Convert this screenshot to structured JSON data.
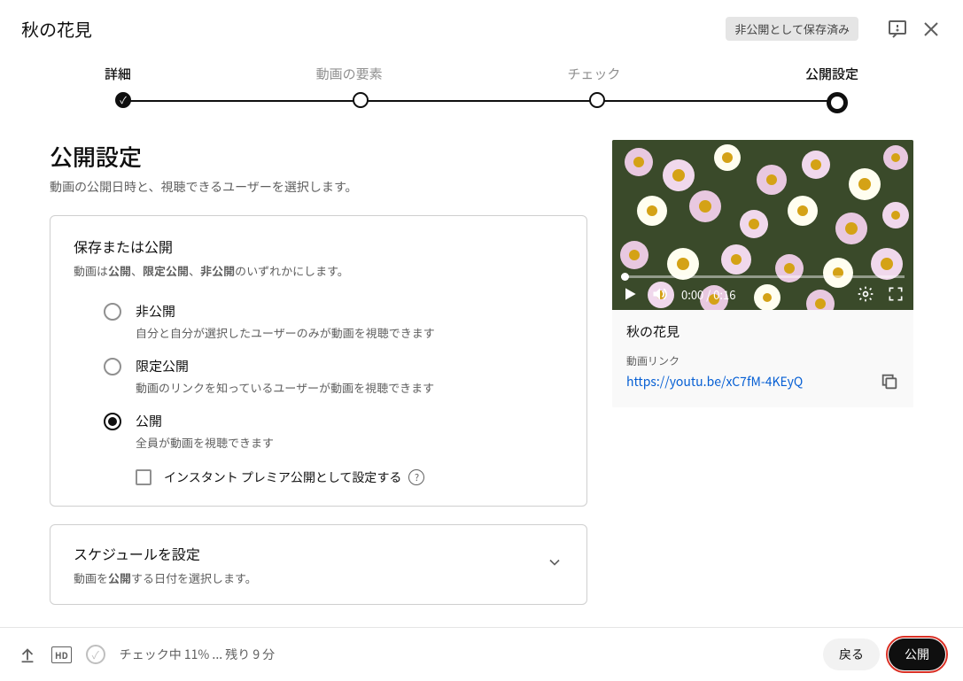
{
  "header": {
    "title": "秋の花見",
    "saved_badge": "非公開として保存済み"
  },
  "stepper": {
    "steps": [
      "詳細",
      "動画の要素",
      "チェック",
      "公開設定"
    ]
  },
  "page": {
    "title": "公開設定",
    "subtitle": "動画の公開日時と、視聴できるユーザーを選択します。"
  },
  "save_card": {
    "title": "保存または公開",
    "sub_prefix": "動画は",
    "sub_b1": "公開",
    "sub_sep1": "、",
    "sub_b2": "限定公開",
    "sub_sep2": "、",
    "sub_b3": "非公開",
    "sub_suffix": "のいずれかにします。",
    "options": [
      {
        "title": "非公開",
        "desc": "自分と自分が選択したユーザーのみが動画を視聴できます"
      },
      {
        "title": "限定公開",
        "desc": "動画のリンクを知っているユーザーが動画を視聴できます"
      },
      {
        "title": "公開",
        "desc": "全員が動画を視聴できます"
      }
    ],
    "instant_premiere": "インスタント プレミア公開として設定する",
    "help": "?"
  },
  "schedule_card": {
    "title": "スケジュールを設定",
    "sub_prefix": "動画を",
    "sub_bold": "公開",
    "sub_suffix": "する日付を選択します。"
  },
  "preview": {
    "time": "0:00 / 0:16",
    "title": "秋の花見",
    "link_label": "動画リンク",
    "link_url": "https://youtu.be/xC7fM-4KEyQ"
  },
  "footer": {
    "hd": "HD",
    "status": "チェック中 11% ... 残り 9 分",
    "back": "戻る",
    "publish": "公開"
  }
}
